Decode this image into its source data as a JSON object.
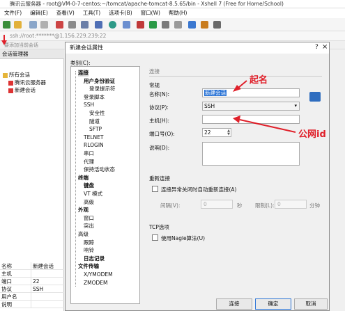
{
  "window": {
    "title": "腾讯云服务器 - root@VM-0-7-centos:~/tomcat/apache-tomcat-8.5.65/bin - Xshell 7 (Free for Home/School)",
    "menu": [
      "文件(F)",
      "编辑(E)",
      "查看(V)",
      "工具(T)",
      "选项卡(B)",
      "窗口(W)",
      "帮助(H)"
    ],
    "address": "ssh://root:*******@1.156.229.239:22",
    "tab_hint": "要添加当前会话"
  },
  "session_manager": {
    "title": "会话管理器",
    "tree": [
      "所有会话",
      "腾讯云服务器",
      "新建会话"
    ],
    "properties": [
      {
        "key": "名称",
        "value": "新建会话"
      },
      {
        "key": "主机",
        "value": ""
      },
      {
        "key": "端口",
        "value": "22"
      },
      {
        "key": "协议",
        "value": "SSH"
      },
      {
        "key": "用户名",
        "value": ""
      },
      {
        "key": "说明",
        "value": ""
      }
    ]
  },
  "dialog": {
    "title": "新建会话属性",
    "help": "?",
    "close": "×",
    "category_label": "类别(C):",
    "categories": [
      {
        "label": "连接",
        "bold": true,
        "indent": 0,
        "selected": true
      },
      {
        "label": "用户身份验证",
        "bold": true,
        "indent": 1
      },
      {
        "label": "登录提示符",
        "bold": false,
        "indent": 2
      },
      {
        "label": "登录脚本",
        "bold": false,
        "indent": 1
      },
      {
        "label": "SSH",
        "bold": false,
        "indent": 1
      },
      {
        "label": "安全性",
        "bold": false,
        "indent": 2
      },
      {
        "label": "隧道",
        "bold": false,
        "indent": 2
      },
      {
        "label": "SFTP",
        "bold": false,
        "indent": 2
      },
      {
        "label": "TELNET",
        "bold": false,
        "indent": 1
      },
      {
        "label": "RLOGIN",
        "bold": false,
        "indent": 1
      },
      {
        "label": "串口",
        "bold": false,
        "indent": 1
      },
      {
        "label": "代理",
        "bold": false,
        "indent": 1
      },
      {
        "label": "保持活动状态",
        "bold": false,
        "indent": 1
      },
      {
        "label": "终端",
        "bold": true,
        "indent": 0
      },
      {
        "label": "键盘",
        "bold": true,
        "indent": 1
      },
      {
        "label": "VT 模式",
        "bold": false,
        "indent": 1
      },
      {
        "label": "高级",
        "bold": false,
        "indent": 1
      },
      {
        "label": "外观",
        "bold": true,
        "indent": 0
      },
      {
        "label": "窗口",
        "bold": false,
        "indent": 1
      },
      {
        "label": "突出",
        "bold": false,
        "indent": 1
      },
      {
        "label": "高级",
        "bold": false,
        "indent": 0
      },
      {
        "label": "跟踪",
        "bold": false,
        "indent": 1
      },
      {
        "label": "响铃",
        "bold": false,
        "indent": 1
      },
      {
        "label": "日志记录",
        "bold": true,
        "indent": 1
      },
      {
        "label": "文件传输",
        "bold": true,
        "indent": 0
      },
      {
        "label": "X/YMODEM",
        "bold": false,
        "indent": 1
      },
      {
        "label": "ZMODEM",
        "bold": false,
        "indent": 1
      }
    ],
    "section_connect": "连接",
    "section_general": "常规",
    "name_label": "名称(N):",
    "name_value": "新建会话",
    "protocol_label": "协议(P):",
    "protocol_value": "SSH",
    "host_label": "主机(H):",
    "host_value": "",
    "port_label": "端口号(O):",
    "port_value": "22",
    "desc_label": "说明(D):",
    "reconnect_title": "重新连接",
    "reconnect_checkbox": "连接异常关闭时自动重新连接(A)",
    "interval_label": "间隔(V):",
    "interval_value": "0",
    "seconds_unit": "秒",
    "limit_label": "限制(L):",
    "limit_value": "0",
    "minutes_unit": "分钟",
    "tcp_title": "TCP选项",
    "nagle_checkbox": "使用Nagle算法(U)",
    "buttons": {
      "connect": "连接",
      "ok": "确定",
      "cancel": "取消"
    }
  },
  "annotations": {
    "name_note": "起名",
    "host_note": "公网id",
    "color": "#e0202a"
  }
}
